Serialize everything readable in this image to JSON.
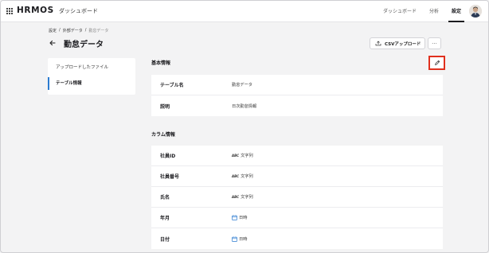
{
  "header": {
    "logo": "HRMOS",
    "app_name": "ダッシュボード",
    "nav": [
      {
        "label": "ダッシュボード",
        "active": false
      },
      {
        "label": "分析",
        "active": false
      },
      {
        "label": "設定",
        "active": true
      }
    ]
  },
  "breadcrumb": [
    "設定",
    "外部データ",
    "勤怠データ"
  ],
  "page": {
    "title": "勤怠データ",
    "csv_button": "CSVアップロード",
    "more_button": "···"
  },
  "sidebar": {
    "items": [
      {
        "label": "アップロードしたファイル",
        "active": false
      },
      {
        "label": "テーブル情報",
        "active": true
      }
    ]
  },
  "basic_info": {
    "title": "基本情報",
    "rows": [
      {
        "key": "テーブル名",
        "value": "勤怠データ"
      },
      {
        "key": "説明",
        "value": "日次勤怠情報"
      }
    ]
  },
  "columns": {
    "title": "カラム情報",
    "rows": [
      {
        "key": "社員ID",
        "type_icon": "abc-icon",
        "type": "文字列"
      },
      {
        "key": "社員番号",
        "type_icon": "abc-icon",
        "type": "文字列"
      },
      {
        "key": "氏名",
        "type_icon": "abc-icon",
        "type": "文字列"
      },
      {
        "key": "年月",
        "type_icon": "calendar-icon",
        "type": "日時"
      },
      {
        "key": "日付",
        "type_icon": "calendar-icon",
        "type": "日時"
      }
    ]
  },
  "colors": {
    "accent": "#2b7bd0",
    "string_type": "#d6249f",
    "highlight": "#e0301e"
  }
}
